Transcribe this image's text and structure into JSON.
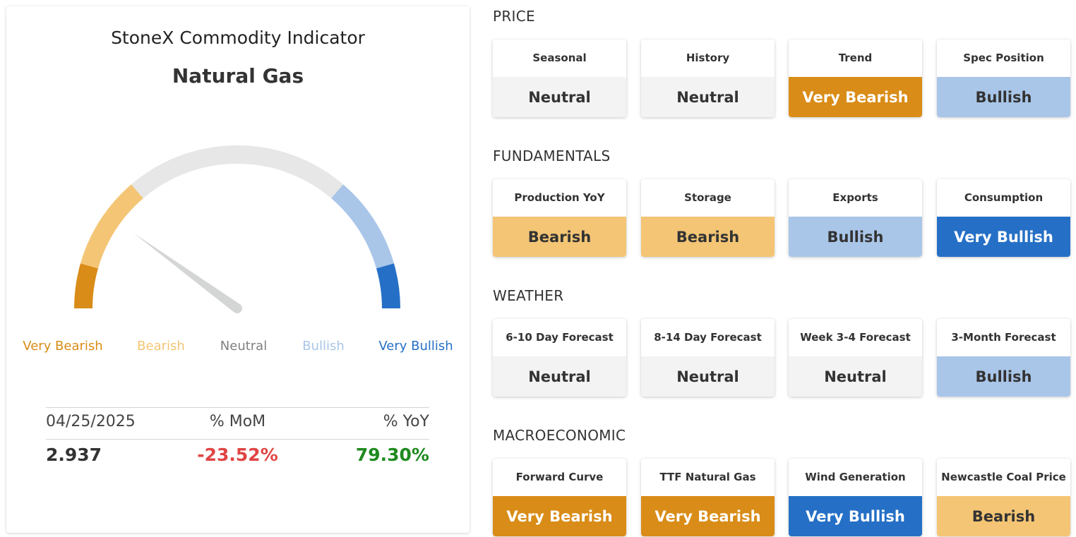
{
  "indicator": {
    "title": "StoneX Commodity Indicator",
    "commodity": "Natural Gas",
    "gauge_position": 0.2
  },
  "legend": [
    {
      "label": "Very Bearish",
      "color": "#D98C17"
    },
    {
      "label": "Bearish",
      "color": "#F4C575"
    },
    {
      "label": "Neutral",
      "color": "#808080"
    },
    {
      "label": "Bullish",
      "color": "#A9C6E8"
    },
    {
      "label": "Very Bullish",
      "color": "#2570C6"
    }
  ],
  "colors": {
    "very_bearish": "#D98C17",
    "bearish": "#F4C575",
    "neutral": "#E6E7E6",
    "bullish": "#A9C6E8",
    "very_bullish": "#2570C6",
    "negative_text": "#E04444",
    "positive_text": "#1E8A1E"
  },
  "stats": {
    "date": "04/25/2025",
    "mom_label": "% MoM",
    "yoy_label": "% YoY",
    "price": "2.937",
    "mom": "-23.52%",
    "yoy": "79.30%"
  },
  "sections": [
    {
      "title": "PRICE",
      "cards": [
        {
          "label": "Seasonal",
          "value": "Neutral",
          "sentiment": "neutral"
        },
        {
          "label": "History",
          "value": "Neutral",
          "sentiment": "neutral"
        },
        {
          "label": "Trend",
          "value": "Very Bearish",
          "sentiment": "very_bearish"
        },
        {
          "label": "Spec Position",
          "value": "Bullish",
          "sentiment": "bullish"
        }
      ]
    },
    {
      "title": "FUNDAMENTALS",
      "cards": [
        {
          "label": "Production YoY",
          "value": "Bearish",
          "sentiment": "bearish"
        },
        {
          "label": "Storage",
          "value": "Bearish",
          "sentiment": "bearish"
        },
        {
          "label": "Exports",
          "value": "Bullish",
          "sentiment": "bullish"
        },
        {
          "label": "Consumption",
          "value": "Very Bullish",
          "sentiment": "very_bullish"
        }
      ]
    },
    {
      "title": "WEATHER",
      "cards": [
        {
          "label": "6-10 Day Forecast",
          "value": "Neutral",
          "sentiment": "neutral"
        },
        {
          "label": "8-14 Day Forecast",
          "value": "Neutral",
          "sentiment": "neutral"
        },
        {
          "label": "Week 3-4 Forecast",
          "value": "Neutral",
          "sentiment": "neutral"
        },
        {
          "label": "3-Month Forecast",
          "value": "Bullish",
          "sentiment": "bullish"
        }
      ]
    },
    {
      "title": "MACROECONOMIC",
      "cards": [
        {
          "label": "Forward Curve",
          "value": "Very Bearish",
          "sentiment": "very_bearish"
        },
        {
          "label": "TTF Natural Gas",
          "value": "Very Bearish",
          "sentiment": "very_bearish"
        },
        {
          "label": "Wind Generation",
          "value": "Very Bullish",
          "sentiment": "very_bullish"
        },
        {
          "label": "Newcastle Coal Price",
          "value": "Bearish",
          "sentiment": "bearish"
        }
      ]
    }
  ]
}
